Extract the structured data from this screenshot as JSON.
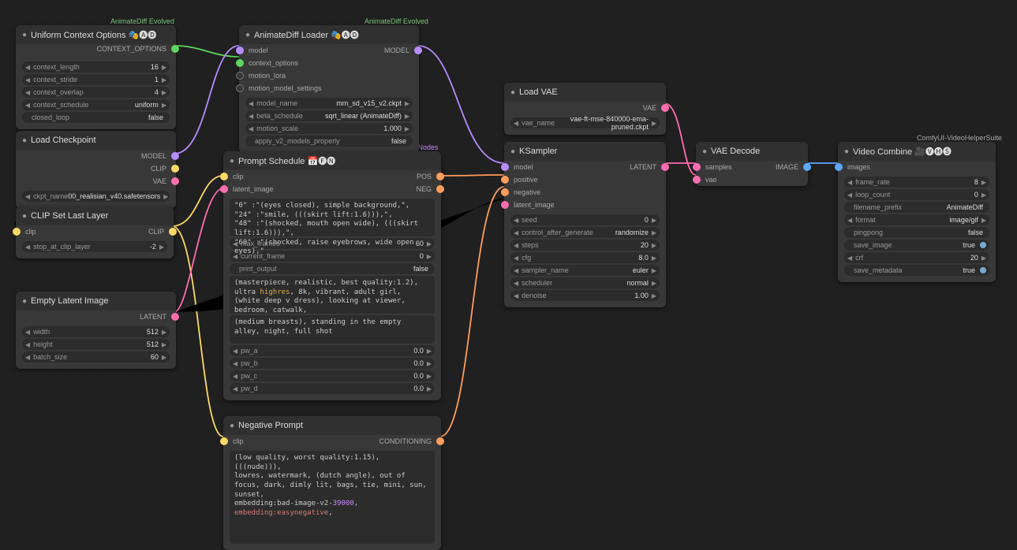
{
  "categories": {
    "animatediff": "AnimateDiff Evolved",
    "fizz": "FizzNodes",
    "video": "ComfyUI-VideoHelperSuite"
  },
  "uco": {
    "title": "Uniform Context Options",
    "icons": "🎭🅐🅓",
    "out": "CONTEXT_OPTIONS",
    "context_length": {
      "l": "context_length",
      "v": "16"
    },
    "context_stride": {
      "l": "context_stride",
      "v": "1"
    },
    "context_overlap": {
      "l": "context_overlap",
      "v": "4"
    },
    "context_schedule": {
      "l": "context_schedule",
      "v": "uniform"
    },
    "closed_loop": {
      "l": "closed_loop",
      "v": "false"
    }
  },
  "adl": {
    "title": "AnimateDiff Loader",
    "icons": "🎭🅐🅓",
    "in_model": "model",
    "in_ctx": "context_options",
    "in_lora": "motion_lora",
    "in_mm": "motion_model_settings",
    "out": "MODEL",
    "model_name": {
      "l": "model_name",
      "v": "mm_sd_v15_v2.ckpt"
    },
    "beta_schedule": {
      "l": "beta_schedule",
      "v": "sqrt_linear (AnimateDiff)"
    },
    "motion_scale": {
      "l": "motion_scale",
      "v": "1.000"
    },
    "apply_v2": {
      "l": "apply_v2_models_properly",
      "v": "false"
    }
  },
  "lc": {
    "title": "Load Checkpoint",
    "out_model": "MODEL",
    "out_clip": "CLIP",
    "out_vae": "VAE",
    "ckpt": {
      "l": "ckpt_name",
      "v": "00_realisian_v40.safetensors"
    }
  },
  "clip": {
    "title": "CLIP Set Last Layer",
    "in": "clip",
    "out": "CLIP",
    "stop": {
      "l": "stop_at_clip_layer",
      "v": "-2"
    }
  },
  "eli": {
    "title": "Empty Latent Image",
    "out": "LATENT",
    "width": {
      "l": "width",
      "v": "512"
    },
    "height": {
      "l": "height",
      "v": "512"
    },
    "batch": {
      "l": "batch_size",
      "v": "60"
    }
  },
  "ps": {
    "title": "Prompt Schedule",
    "icons": "📅🅕🅝",
    "in_clip": "clip",
    "out_pos": "POS",
    "out_neg": "NEG",
    "sched_text": "\"0\" :\"(eyes closed), simple background,\",\n\"24\" :\"smile, (((skirt lift:1.6))),\",\n\"48\" :\"(shocked, mouth open wide), (((skirt lift:1.6))),\",\n\"60\" :\"(shocked, raise eyebrows, wide open eyes),\"",
    "max_frames": {
      "l": "max_frames",
      "v": "60"
    },
    "current_frame": {
      "l": "current_frame",
      "v": "0"
    },
    "print_output": {
      "l": "print_output",
      "v": "false"
    },
    "prompt_pre": "(masterpiece, realistic, best quality:1.2), ultra ",
    "prompt_hl": "highres",
    "prompt_post": ", 8k, vibrant, adult girl, (white deep v dress), looking at viewer, bedroom, catwalk,",
    "prompt2": "(medium breasts), standing in the empty alley, night, full shot",
    "pw_a": {
      "l": "pw_a",
      "v": "0.0"
    },
    "pw_b": {
      "l": "pw_b",
      "v": "0.0"
    },
    "pw_c": {
      "l": "pw_c",
      "v": "0.0"
    },
    "pw_d": {
      "l": "pw_d",
      "v": "0.0"
    }
  },
  "np": {
    "title": "Negative Prompt",
    "in": "clip",
    "out": "CONDITIONING",
    "text_pre": "(low quality, worst quality:1.15), (((nude))),\nlowres, watermark, (dutch angle), out of focus, dark, dimly lit, bags, tie, mini, sun, sunset,\nembedding:bad-image-v2-",
    "text_num": "39000",
    "text_mid": ",\n",
    "text_emb": "embedding:easynegative",
    "text_end": ","
  },
  "lvae": {
    "title": "Load VAE",
    "out": "VAE",
    "vae": {
      "l": "vae_name",
      "v": "vae-ft-mse-840000-ema-pruned.ckpt"
    }
  },
  "ks": {
    "title": "KSampler",
    "in_model": "model",
    "in_pos": "positive",
    "in_neg": "negative",
    "in_lat": "latent_image",
    "out": "LATENT",
    "seed": {
      "l": "seed",
      "v": "0"
    },
    "control": {
      "l": "control_after_generate",
      "v": "randomize"
    },
    "steps": {
      "l": "steps",
      "v": "20"
    },
    "cfg": {
      "l": "cfg",
      "v": "8.0"
    },
    "sampler": {
      "l": "sampler_name",
      "v": "euler"
    },
    "scheduler": {
      "l": "scheduler",
      "v": "normal"
    },
    "denoise": {
      "l": "denoise",
      "v": "1.00"
    }
  },
  "vd": {
    "title": "VAE Decode",
    "in_samples": "samples",
    "in_vae": "vae",
    "out": "IMAGE"
  },
  "vc": {
    "title": "Video Combine",
    "icons": "🎥🅥🅗🅢",
    "in": "images",
    "frame_rate": {
      "l": "frame_rate",
      "v": "8"
    },
    "loop": {
      "l": "loop_count",
      "v": "0"
    },
    "prefix": {
      "l": "filename_prefix",
      "v": "AnimateDiff"
    },
    "format": {
      "l": "format",
      "v": "image/gif"
    },
    "pingpong": {
      "l": "pingpong",
      "v": "false"
    },
    "save_image": {
      "l": "save_image",
      "v": "true"
    },
    "crf": {
      "l": "crf",
      "v": "20"
    },
    "save_meta": {
      "l": "save_metadata",
      "v": "true"
    }
  }
}
